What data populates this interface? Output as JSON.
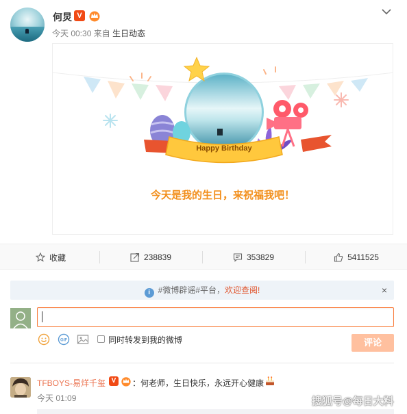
{
  "post": {
    "author": "何炅",
    "badge": "V",
    "time": "今天 00:30",
    "from_prefix": "来自",
    "source": "生日动态"
  },
  "birthday_card": {
    "banner": "Happy Birthday",
    "message": "今天是我的生日，来祝福我吧！"
  },
  "actions": {
    "favorite": "收藏",
    "repost_count": "238839",
    "comment_count": "353829",
    "like_count": "5411525"
  },
  "notice": {
    "text": "#微博辟谣#平台，",
    "link": "欢迎查阅!",
    "close": "×"
  },
  "composer": {
    "input_value": "",
    "repost_option": "同时转发到我的微博",
    "submit": "评论"
  },
  "comment": {
    "user": "TFBOYS-易烊千玺",
    "badge": "V",
    "text": "：何老师，生日快乐，永远开心健康",
    "time": "今天 01:09"
  },
  "watermark": "搜狐号@每日大料",
  "colors": {
    "accent_orange": "#fa7d3c",
    "birthday_text": "#f28f1c",
    "username": "#eb7350",
    "vip_red": "#f14a15"
  },
  "icons": [
    "star-icon",
    "repost-icon",
    "comment-icon",
    "like-icon",
    "info-icon",
    "emoji-icon",
    "gif-icon",
    "image-icon",
    "chevron-down-icon",
    "crown-icon",
    "cake-icon"
  ]
}
